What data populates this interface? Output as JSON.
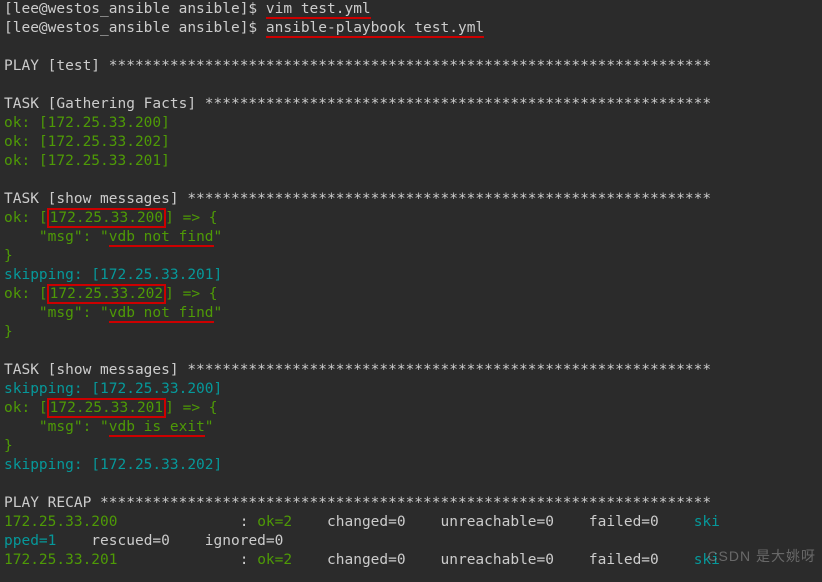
{
  "prompt_line1_a": "[lee@westos_ansible ansible]$ ",
  "prompt_line1_cmd": "vim test.yml",
  "prompt_line2_a": "[lee@westos_ansible ansible]$ ",
  "prompt_line2_cmd": "ansible-playbook test.yml",
  "blank": "",
  "play_header": "PLAY [test] *********************************************************************",
  "task_gather": "TASK [Gathering Facts] **********************************************************",
  "ok200": "ok: [172.25.33.200]",
  "ok202": "ok: [172.25.33.202]",
  "ok201": "ok: [172.25.33.201]",
  "task_show": "TASK [show messages] ************************************************************",
  "ok_prefix": "ok: [",
  "ip200": "172.25.33.200",
  "ip201": "172.25.33.201",
  "ip202": "172.25.33.202",
  "arrow": "] => {",
  "msg_key": "    \"msg\": \"",
  "msg_vdb_notfind": "vdb not find",
  "msg_vdb_isexit": "vdb is exit",
  "msg_close": "\"",
  "brace_close": "}",
  "skipping_prefix": "skipping: [",
  "skipping_suffix": "]",
  "recap_header": "PLAY RECAP **********************************************************************",
  "recap_ip200": "172.25.33.200",
  "recap_pad200": "              : ",
  "recap_ok2": "ok=2   ",
  "recap_changed": " changed=0    unreachable=0    failed=0    ",
  "recap_ski": "ski",
  "recap_pped1": "pped=1",
  "recap_rest": "    rescued=0    ignored=0 ",
  "recap_ip201": "172.25.33.201",
  "recap_ok2b": "ok=2   ",
  "recap_changed_b": " changed=0    unreachable=0    failed=0    ",
  "recap_ski_b": "ski",
  "watermark": "CSDN 是大姚呀"
}
